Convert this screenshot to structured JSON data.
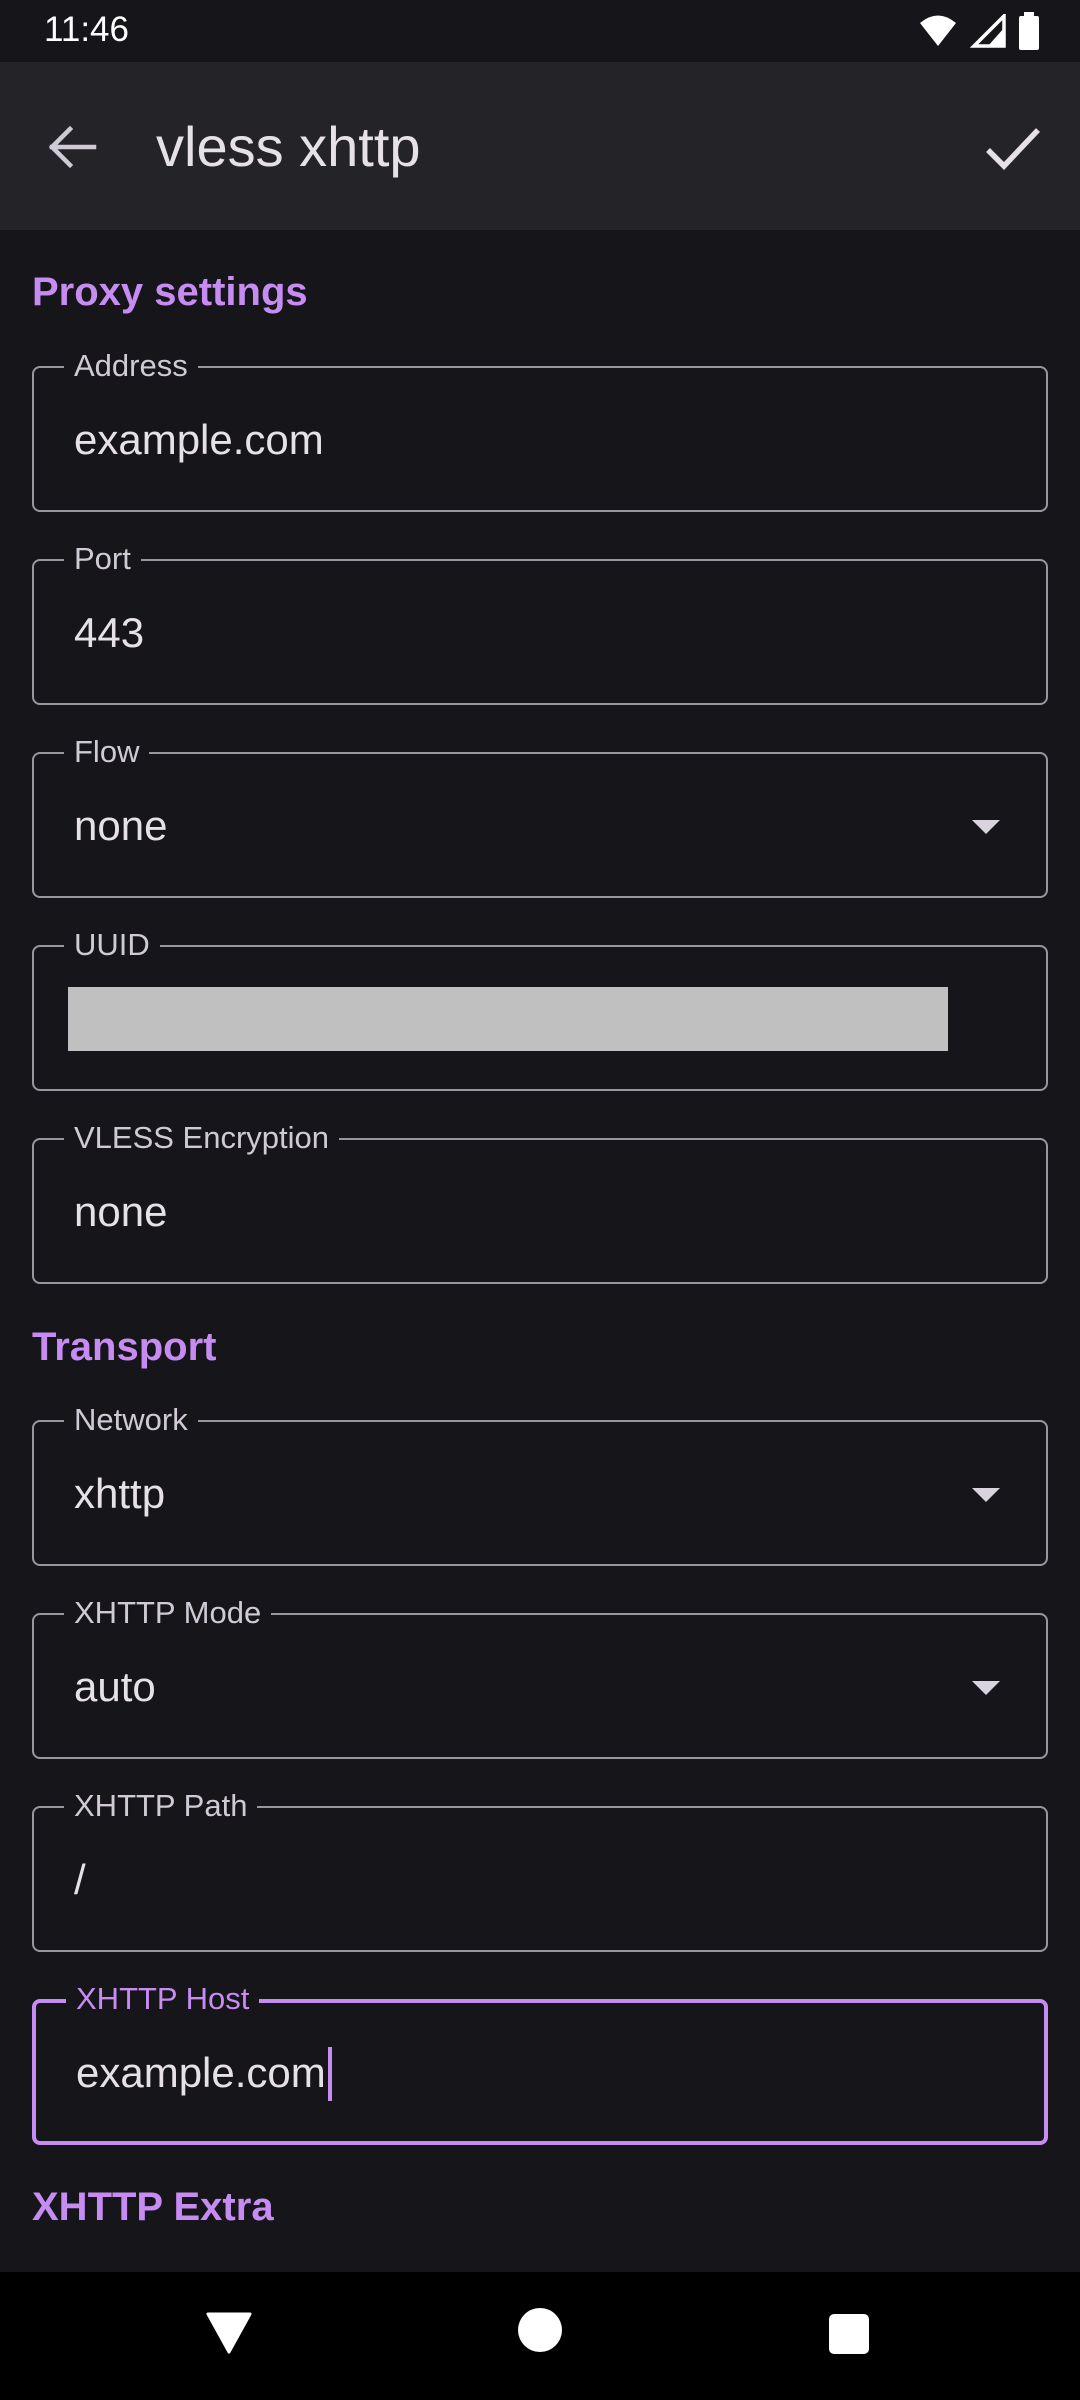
{
  "status_bar": {
    "time": "11:46",
    "icons": [
      "wifi-icon",
      "cell-signal-icon",
      "battery-icon"
    ]
  },
  "app_bar": {
    "title": "vless xhttp",
    "back_icon": "arrow-back-icon",
    "confirm_icon": "check-icon"
  },
  "sections": {
    "proxy": {
      "title": "Proxy settings"
    },
    "transport": {
      "title": "Transport"
    },
    "extra": {
      "title": "XHTTP Extra"
    }
  },
  "fields": {
    "address": {
      "label": "Address",
      "value": "example.com"
    },
    "port": {
      "label": "Port",
      "value": "443"
    },
    "flow": {
      "label": "Flow",
      "value": "none"
    },
    "uuid": {
      "label": "UUID",
      "value": ""
    },
    "vless_encryption": {
      "label": "VLESS Encryption",
      "value": "none"
    },
    "network": {
      "label": "Network",
      "value": "xhttp"
    },
    "xhttp_mode": {
      "label": "XHTTP Mode",
      "value": "auto"
    },
    "xhttp_path": {
      "label": "XHTTP Path",
      "value": "/"
    },
    "xhttp_host": {
      "label": "XHTTP Host",
      "value": "example.com"
    }
  },
  "colors": {
    "accent": "#c68cf2",
    "background": "#16151a",
    "app_bar": "#242328",
    "outline": "#9a96a0"
  },
  "nav_bar": {
    "icons": [
      "nav-back-icon",
      "nav-home-icon",
      "nav-recents-icon"
    ]
  }
}
